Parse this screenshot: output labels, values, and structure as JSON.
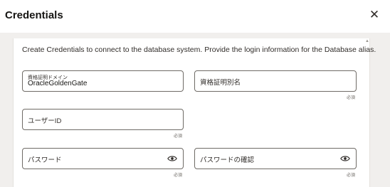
{
  "dialog": {
    "title": "Credentials",
    "close_symbol": "✕"
  },
  "description": "Create Credentials to connect to the database system. Provide the login information for the Database alias.",
  "fields": {
    "domain": {
      "label": "資格証明ドメイン",
      "value": "OracleGoldenGate"
    },
    "alias": {
      "placeholder": "資格証明別名",
      "required": "必須"
    },
    "user_id": {
      "placeholder": "ユーザーID",
      "required": "必須"
    },
    "password": {
      "placeholder": "パスワード",
      "required": "必須",
      "icon": "eye-icon"
    },
    "confirm_password": {
      "placeholder": "パスワードの確認",
      "required": "必須",
      "icon": "eye-icon"
    }
  }
}
